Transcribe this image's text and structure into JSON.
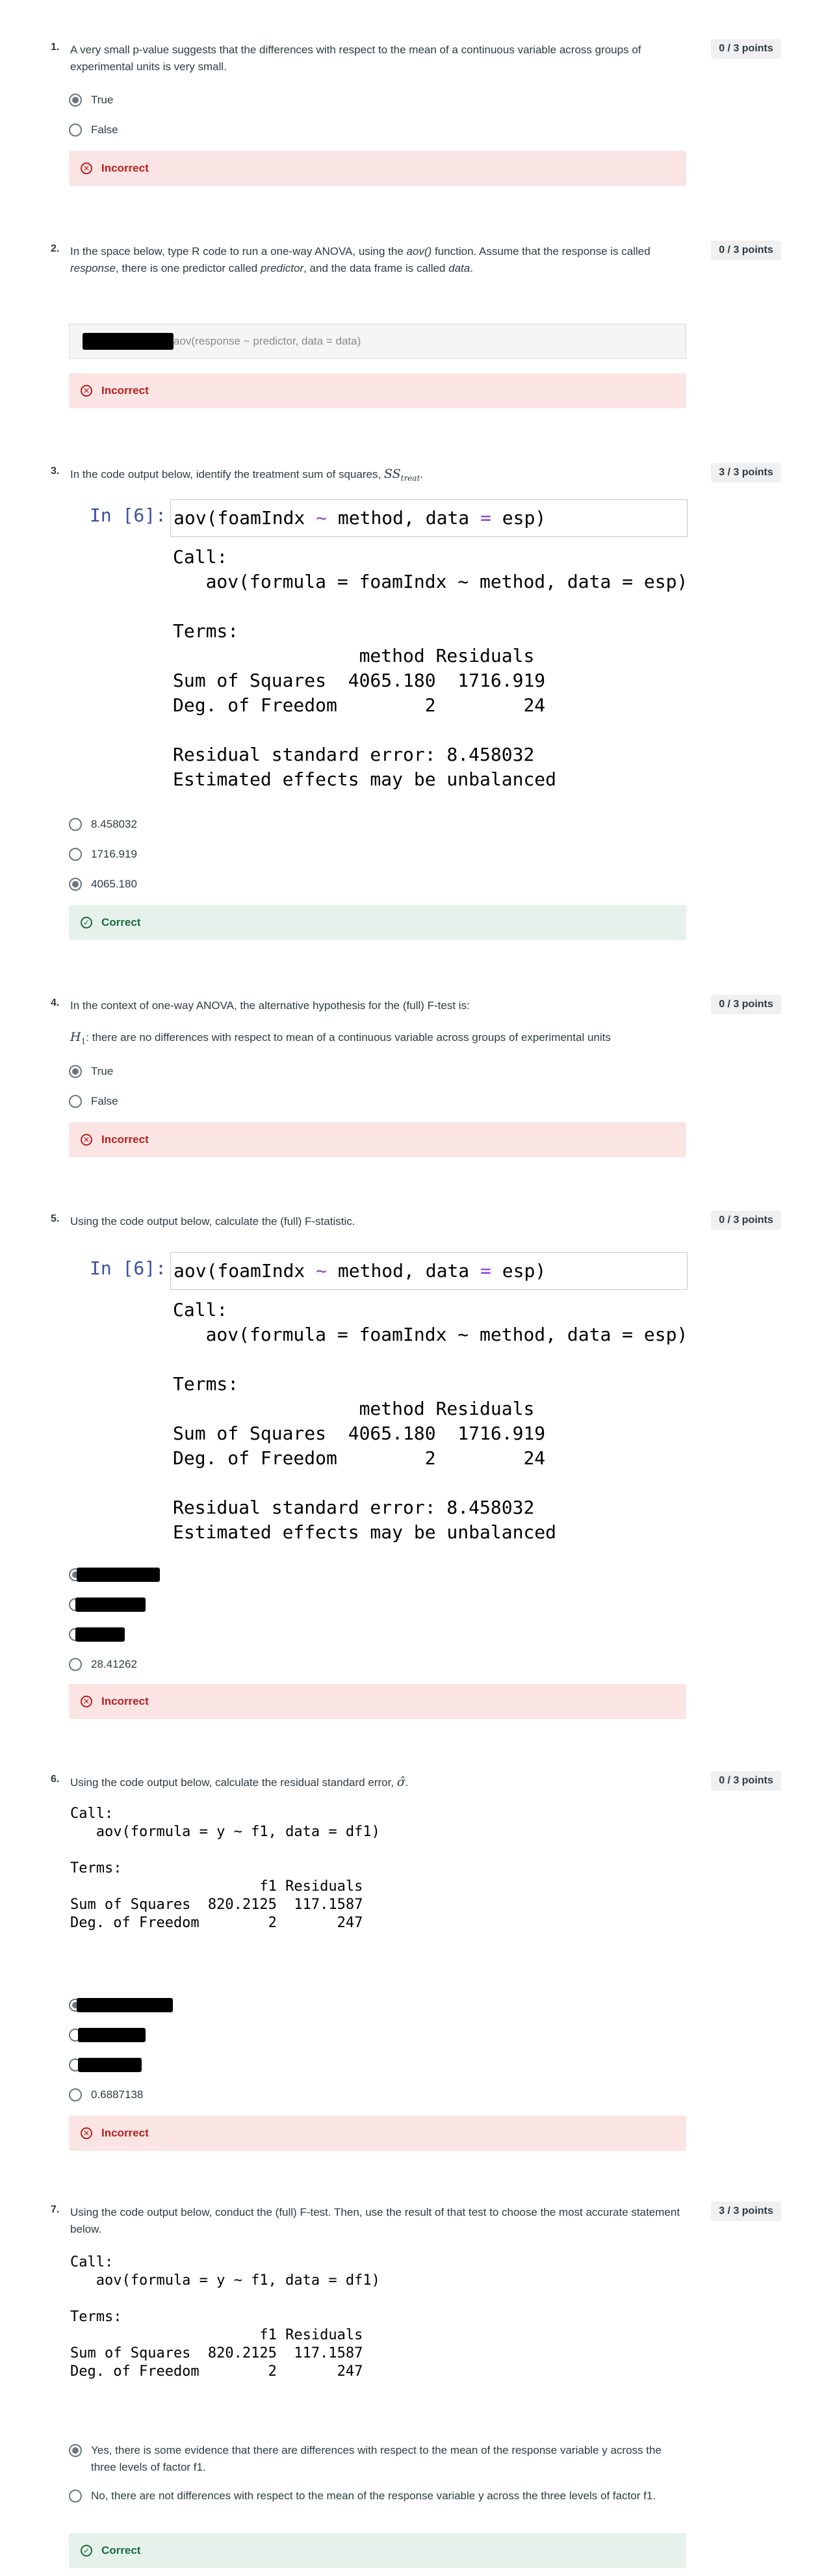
{
  "q1": {
    "number": "1.",
    "text": "A very small p-value suggests that the differences with respect to the mean of a continuous variable across groups of experimental units is very small.",
    "points": "0 / 3 points",
    "options": [
      "True",
      "False"
    ],
    "selected": 0,
    "feedback": "Incorrect"
  },
  "q2": {
    "number": "2.",
    "text_parts": [
      "In the space below, type R code to run a one-way ANOVA, using the ",
      "aov()",
      " function. Assume that the response is called ",
      "response",
      ", there is one predictor called ",
      "predictor",
      ", and the data frame is called ",
      "data",
      "."
    ],
    "points": "0 / 3 points",
    "answer": "aov(response ~ predictor, data = data)",
    "feedback": "Incorrect"
  },
  "q3": {
    "number": "3.",
    "text": "In the code output below, identify the treatment sum of squares,",
    "math_main": "SS",
    "math_sub": "treat",
    "points": "3 / 3 points",
    "prompt": "In [6]:",
    "code_fn": "aov(foamIndx ",
    "code_tilde": "~",
    "code_mid": " method, data ",
    "code_eq": "=",
    "code_end": " esp)",
    "output": "Call:\n   aov(formula = foamIndx ~ method, data = esp)\n\nTerms:\n                 method Residuals\nSum of Squares  4065.180  1716.919\nDeg. of Freedom        2        24\n\nResidual standard error: 8.458032\nEstimated effects may be unbalanced",
    "options": [
      "8.458032",
      "1716.919",
      "4065.180"
    ],
    "selected": 2,
    "feedback": "Correct"
  },
  "q4": {
    "number": "4.",
    "text": "In the context of one-way ANOVA, the alternative hypothesis for the (full) F-test is:",
    "math_main": "H",
    "math_sub": "1",
    "statement": ": there are no differences with respect to mean of a continuous variable across groups of experimental units",
    "points": "0 / 3 points",
    "options": [
      "True",
      "False"
    ],
    "selected": 0,
    "feedback": "Incorrect"
  },
  "q5": {
    "number": "5.",
    "text": "Using the code output below, calculate the (full) F-statistic.",
    "points": "0 / 3 points",
    "prompt": "In [6]:",
    "code_fn": "aov(foamIndx ",
    "code_tilde": "~",
    "code_mid": " method, data ",
    "code_eq": "=",
    "code_end": " esp)",
    "output": "Call:\n   aov(formula = foamIndx ~ method, data = esp)\n\nTerms:\n                 method Residuals\nSum of Squares  4065.180  1716.919\nDeg. of Freedom        2        24\n\nResidual standard error: 8.458032\nEstimated effects may be unbalanced",
    "last_option": "28.41262",
    "feedback": "Incorrect"
  },
  "q6": {
    "number": "6.",
    "text": "Using the code output below, calculate the residual standard error,",
    "math_main": "σ̂",
    "points": "0 / 3 points",
    "output": "Call:\n   aov(formula = y ~ f1, data = df1)\n\nTerms:\n                      f1 Residuals\nSum of Squares  820.2125  117.1587\nDeg. of Freedom        2       247",
    "last_option": "0.6887138",
    "feedback": "Incorrect"
  },
  "q7": {
    "number": "7.",
    "text": "Using the code output below, conduct the (full) F-test. Then, use the result of that test to choose the most accurate statement below.",
    "points": "3 / 3 points",
    "output": "Call:\n   aov(formula = y ~ f1, data = df1)\n\nTerms:\n                      f1 Residuals\nSum of Squares  820.2125  117.1587\nDeg. of Freedom        2       247",
    "options": [
      "Yes, there is some evidence that there are differences with respect to the mean of the response variable y across the three levels of factor f1.",
      "No, there are not differences with respect to the mean of the response variable y across the three levels of factor f1."
    ],
    "selected": 0,
    "feedback": "Correct"
  }
}
